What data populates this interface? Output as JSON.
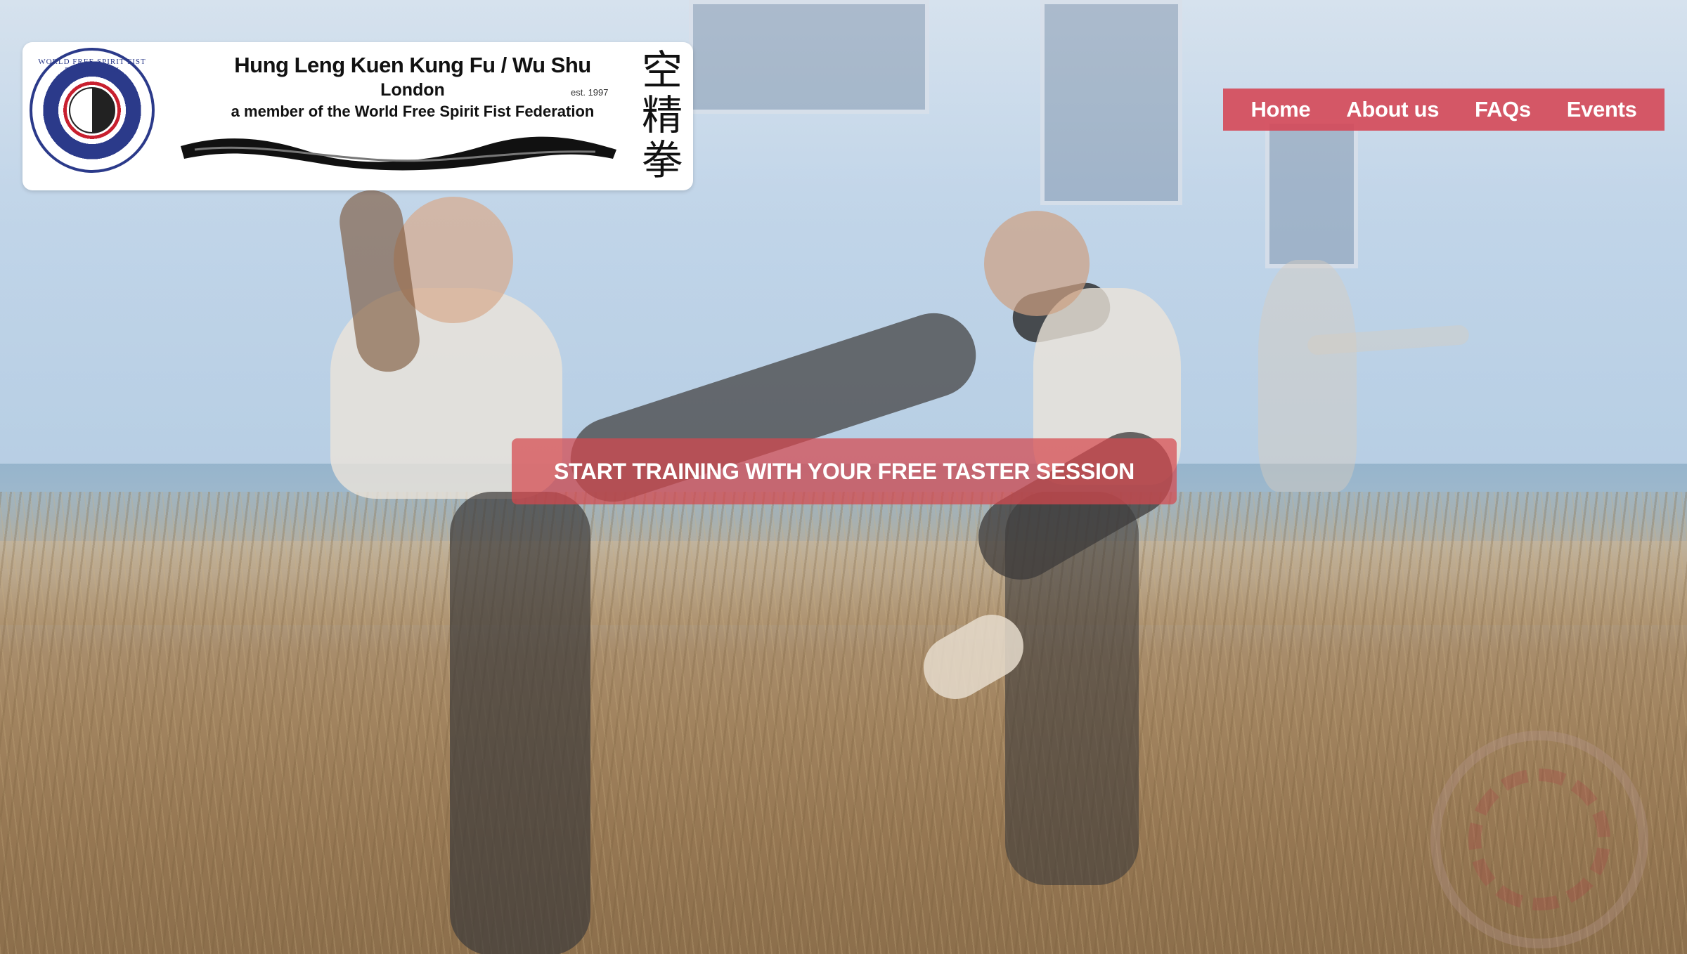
{
  "logo": {
    "title": "Hung Leng Kuen Kung Fu / Wu Shu",
    "subtitle": "London",
    "est": "est. 1997",
    "member_line": "a member of the World Free Spirit Fist Federation",
    "seal_text": "WORLD FREE SPIRIT FIST FEDERATION",
    "chinese": "空精拳"
  },
  "nav": {
    "items": [
      {
        "label": "Home"
      },
      {
        "label": "About us"
      },
      {
        "label": "FAQs"
      },
      {
        "label": "Events"
      }
    ]
  },
  "hero": {
    "cta_label": "START TRAINING WITH YOUR FREE TASTER SESSION"
  },
  "colors": {
    "nav_bg": "#d54858",
    "cta_bg": "#d6484e",
    "text_light": "#ffffff"
  }
}
